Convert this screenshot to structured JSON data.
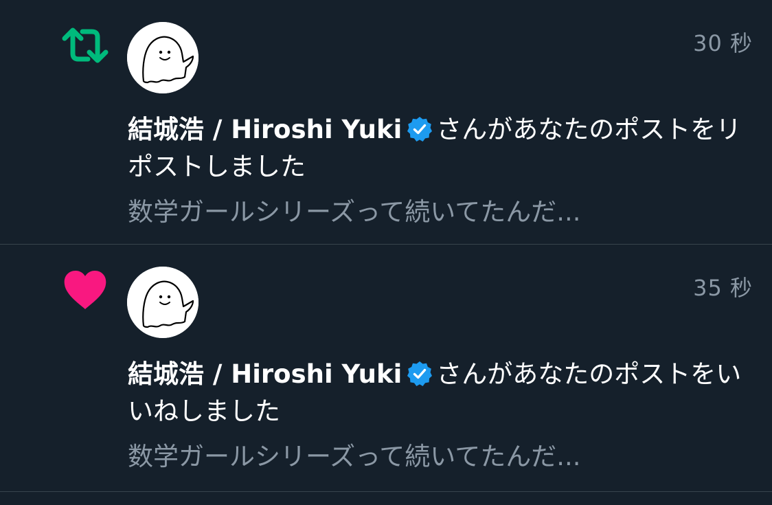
{
  "notifications": [
    {
      "type": "repost",
      "icon": "repost-icon",
      "icon_color": "#00ba7c",
      "timestamp": "30 秒",
      "user_name": "結城浩 / Hiroshi Yuki",
      "verified": true,
      "action_text": "さんがあなたのポストをリポストしました",
      "preview": "数学ガールシリーズって続いてたんだ..."
    },
    {
      "type": "like",
      "icon": "heart-icon",
      "icon_color": "#f91880",
      "timestamp": "35 秒",
      "user_name": "結城浩 / Hiroshi Yuki",
      "verified": true,
      "action_text": "さんがあなたのポストをいいねしました",
      "preview": "数学ガールシリーズって続いてたんだ..."
    }
  ],
  "colors": {
    "background": "#15202b",
    "divider": "#38444d",
    "secondary_text": "#8b98a5",
    "verified_blue": "#1d9bf0"
  }
}
